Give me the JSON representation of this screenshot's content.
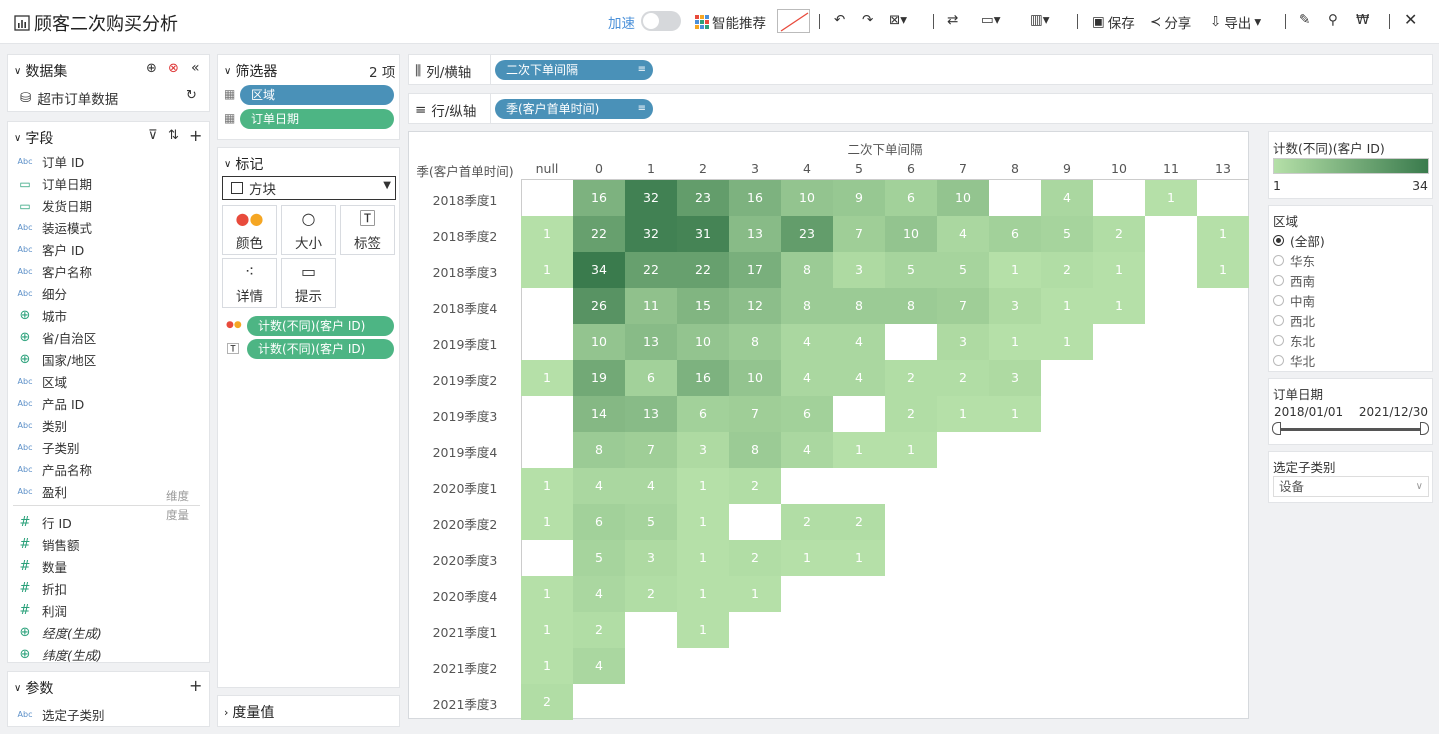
{
  "app": {
    "title": "顾客二次购买分析"
  },
  "toolbar": {
    "accelerate": "加速",
    "smart": "智能推荐",
    "save": "保存",
    "share": "分享",
    "export": "导出"
  },
  "dataset": {
    "title": "数据集",
    "source": "超市订单数据"
  },
  "fields": {
    "title": "字段",
    "dimension_label": "维度",
    "measure_label": "度量",
    "dimensions": [
      {
        "name": "订单 ID",
        "type": "text"
      },
      {
        "name": "订单日期",
        "type": "date"
      },
      {
        "name": "发货日期",
        "type": "date"
      },
      {
        "name": "装运模式",
        "type": "text"
      },
      {
        "name": "客户 ID",
        "type": "text"
      },
      {
        "name": "客户名称",
        "type": "text"
      },
      {
        "name": "细分",
        "type": "text"
      },
      {
        "name": "城市",
        "type": "geo"
      },
      {
        "name": "省/自治区",
        "type": "geo"
      },
      {
        "name": "国家/地区",
        "type": "geo"
      },
      {
        "name": "区域",
        "type": "text"
      },
      {
        "name": "产品 ID",
        "type": "text"
      },
      {
        "name": "类别",
        "type": "text"
      },
      {
        "name": "子类别",
        "type": "text"
      },
      {
        "name": "产品名称",
        "type": "text"
      },
      {
        "name": "盈利",
        "type": "text"
      }
    ],
    "measures": [
      {
        "name": "行 ID",
        "type": "num"
      },
      {
        "name": "销售额",
        "type": "num"
      },
      {
        "name": "数量",
        "type": "num"
      },
      {
        "name": "折扣",
        "type": "num"
      },
      {
        "name": "利润",
        "type": "num"
      },
      {
        "name": "经度(生成)",
        "type": "geo"
      },
      {
        "name": "纬度(生成)",
        "type": "geo"
      }
    ]
  },
  "params": {
    "title": "参数",
    "items": [
      "选定子类别"
    ]
  },
  "filters": {
    "title": "筛选器",
    "count": "2 项",
    "items": [
      "区域",
      "订单日期"
    ]
  },
  "marks": {
    "title": "标记",
    "type": "方块",
    "buttons": [
      "颜色",
      "大小",
      "标签",
      "详情",
      "提示"
    ],
    "pills": [
      "计数(不同)(客户 ID)",
      "计数(不同)(客户 ID)"
    ]
  },
  "measure_values": {
    "title": "度量值"
  },
  "shelves": {
    "columns_label": "列/横轴",
    "columns_pill": "二次下单间隔",
    "rows_label": "行/纵轴",
    "rows_pill": "季(客户首单时间)"
  },
  "legend": {
    "title": "计数(不同)(客户 ID)",
    "min": "1",
    "max": "34",
    "color_min": "#b5e0a8",
    "color_max": "#3a7b4d"
  },
  "region_filter": {
    "title": "区域",
    "options": [
      "(全部)",
      "华东",
      "西南",
      "中南",
      "西北",
      "东北",
      "华北"
    ],
    "selected": 0
  },
  "date_filter": {
    "title": "订单日期",
    "start": "2018/01/01",
    "end": "2021/12/30"
  },
  "subcat_param": {
    "title": "选定子类别",
    "value": "设备"
  },
  "chart_data": {
    "type": "heatmap",
    "x_title": "二次下单间隔",
    "y_title": "季(客户首单时间)",
    "x": [
      "null",
      "0",
      "1",
      "2",
      "3",
      "4",
      "5",
      "6",
      "7",
      "8",
      "9",
      "10",
      "11",
      "13"
    ],
    "y": [
      "2018季度1",
      "2018季度2",
      "2018季度3",
      "2018季度4",
      "2019季度1",
      "2019季度2",
      "2019季度3",
      "2019季度4",
      "2020季度1",
      "2020季度2",
      "2020季度3",
      "2020季度4",
      "2021季度1",
      "2021季度2",
      "2021季度3"
    ],
    "values": [
      [
        null,
        16,
        32,
        23,
        16,
        10,
        9,
        6,
        10,
        null,
        4,
        null,
        1,
        null
      ],
      [
        1,
        22,
        32,
        31,
        13,
        23,
        7,
        10,
        4,
        6,
        5,
        2,
        null,
        1
      ],
      [
        1,
        34,
        22,
        22,
        17,
        8,
        3,
        5,
        5,
        1,
        2,
        1,
        null,
        1
      ],
      [
        null,
        26,
        11,
        15,
        12,
        8,
        8,
        8,
        7,
        3,
        1,
        1,
        null,
        null
      ],
      [
        null,
        10,
        13,
        10,
        8,
        4,
        4,
        null,
        3,
        1,
        1,
        null,
        null,
        null
      ],
      [
        1,
        19,
        6,
        16,
        10,
        4,
        4,
        2,
        2,
        3,
        null,
        null,
        null,
        null
      ],
      [
        null,
        14,
        13,
        6,
        7,
        6,
        null,
        2,
        1,
        1,
        null,
        null,
        null,
        null
      ],
      [
        null,
        8,
        7,
        3,
        8,
        4,
        1,
        1,
        null,
        null,
        null,
        null,
        null,
        null
      ],
      [
        1,
        4,
        4,
        1,
        2,
        null,
        null,
        null,
        null,
        null,
        null,
        null,
        null,
        null
      ],
      [
        1,
        6,
        5,
        1,
        null,
        2,
        2,
        null,
        null,
        null,
        null,
        null,
        null,
        null
      ],
      [
        null,
        5,
        3,
        1,
        2,
        1,
        1,
        null,
        null,
        null,
        null,
        null,
        null,
        null
      ],
      [
        1,
        4,
        2,
        1,
        1,
        null,
        null,
        null,
        null,
        null,
        null,
        null,
        null,
        null
      ],
      [
        1,
        2,
        null,
        1,
        null,
        null,
        null,
        null,
        null,
        null,
        null,
        null,
        null,
        null
      ],
      [
        1,
        4,
        null,
        null,
        null,
        null,
        null,
        null,
        null,
        null,
        null,
        null,
        null,
        null
      ],
      [
        2,
        null,
        null,
        null,
        null,
        null,
        null,
        null,
        null,
        null,
        null,
        null,
        null,
        null
      ]
    ],
    "color_range": [
      1,
      34
    ]
  }
}
